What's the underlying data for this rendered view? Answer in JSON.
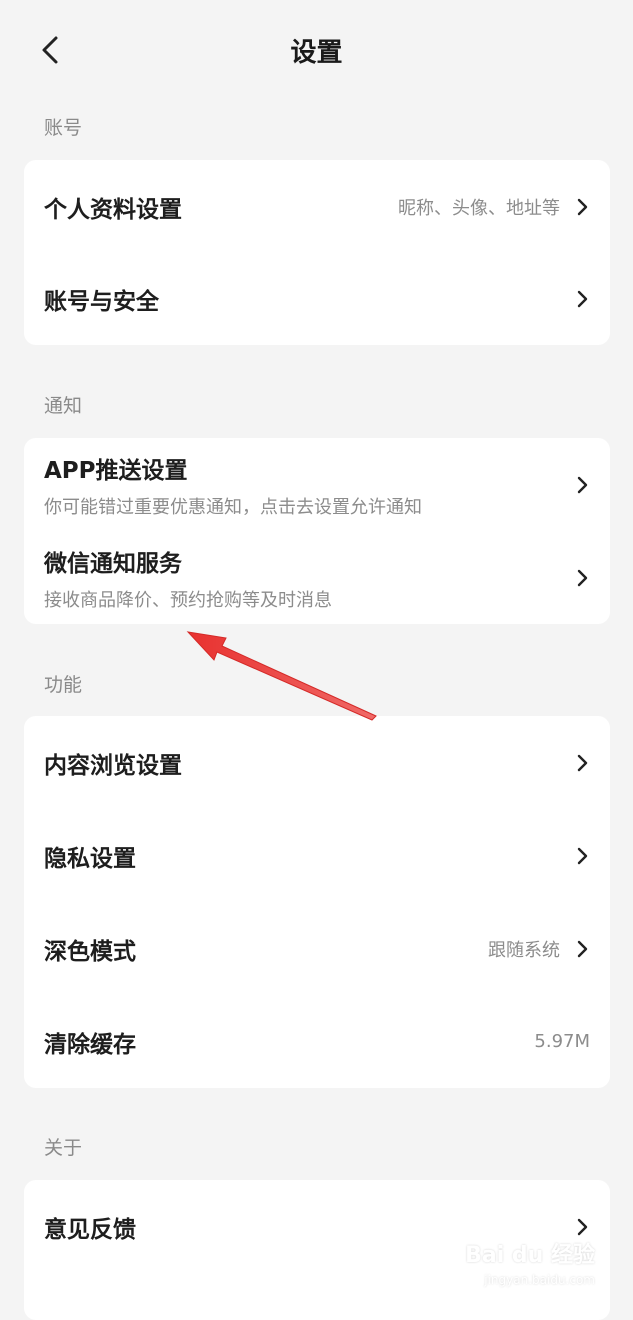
{
  "header": {
    "title": "设置",
    "back_icon": "chevron-left-icon"
  },
  "sections": [
    {
      "label": "账号",
      "items": [
        {
          "title": "个人资料设置",
          "hint": "昵称、头像、地址等"
        },
        {
          "title": "账号与安全",
          "hint": ""
        }
      ]
    },
    {
      "label": "通知",
      "items": [
        {
          "title": "APP推送设置",
          "subtitle": "你可能错过重要优惠通知，点击去设置允许通知"
        },
        {
          "title": "微信通知服务",
          "subtitle": "接收商品降价、预约抢购等及时消息"
        }
      ]
    },
    {
      "label": "功能",
      "items": [
        {
          "title": "内容浏览设置",
          "hint": ""
        },
        {
          "title": "隐私设置",
          "hint": ""
        },
        {
          "title": "深色模式",
          "hint": "跟随系统"
        },
        {
          "title": "清除缓存",
          "hint": "5.97M"
        }
      ]
    },
    {
      "label": "关于",
      "items": [
        {
          "title": "意见反馈",
          "hint": ""
        }
      ]
    }
  ],
  "annotation": {
    "color": "#e8312f"
  },
  "watermark": {
    "brand": "Bai du 经验",
    "url": "jingyan.baidu.com"
  }
}
